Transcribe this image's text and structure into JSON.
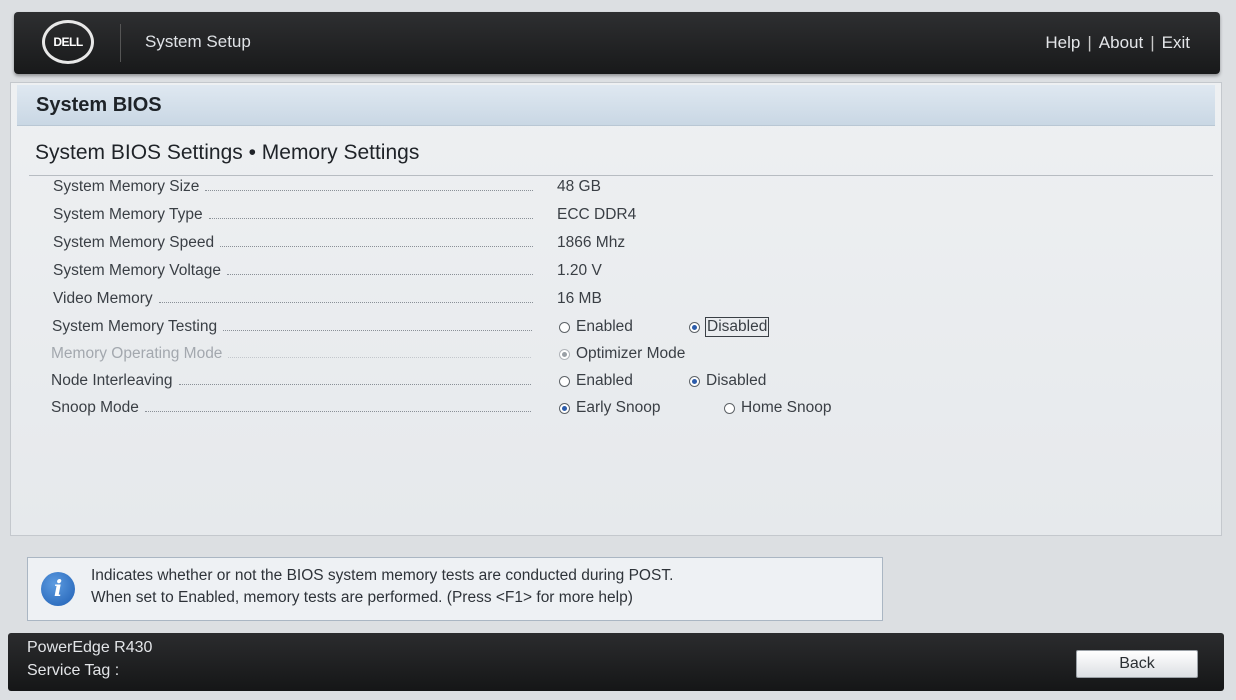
{
  "header": {
    "logo_text": "DELL",
    "app_title": "System Setup",
    "links": [
      "Help",
      "About",
      "Exit"
    ],
    "separator": "|"
  },
  "panel": {
    "title": "System BIOS",
    "breadcrumb": "System BIOS Settings • Memory Settings"
  },
  "settings": {
    "memory_size": {
      "label": "System Memory Size",
      "value": "48 GB"
    },
    "memory_type": {
      "label": "System Memory Type",
      "value": "ECC DDR4"
    },
    "memory_speed": {
      "label": "System Memory Speed",
      "value": "1866 Mhz"
    },
    "memory_voltage": {
      "label": "System Memory Voltage",
      "value": "1.20 V"
    },
    "video_memory": {
      "label": "Video Memory",
      "value": "16 MB"
    },
    "memory_testing": {
      "label": "System Memory Testing",
      "options": [
        "Enabled",
        "Disabled"
      ],
      "selected": "Disabled"
    },
    "operating_mode": {
      "label": "Memory Operating Mode",
      "options": [
        "Optimizer Mode"
      ],
      "selected": "Optimizer Mode",
      "disabled": true
    },
    "node_interleaving": {
      "label": "Node Interleaving",
      "options": [
        "Enabled",
        "Disabled"
      ],
      "selected": "Disabled"
    },
    "snoop_mode": {
      "label": "Snoop Mode",
      "options": [
        "Early Snoop",
        "Home Snoop"
      ],
      "selected": "Early Snoop"
    }
  },
  "help": {
    "icon": "info-icon",
    "line1": "Indicates whether or not the BIOS system memory tests are conducted during POST.",
    "line2": "When set to Enabled, memory tests are performed. (Press <F1> for more help)"
  },
  "footer": {
    "model": "PowerEdge R430",
    "service_tag_label": "Service Tag :",
    "back_label": "Back"
  },
  "colors": {
    "header_bg": "#1f2021",
    "panel_head": "#cfdce8",
    "radio_selected": "#2c5cab"
  }
}
